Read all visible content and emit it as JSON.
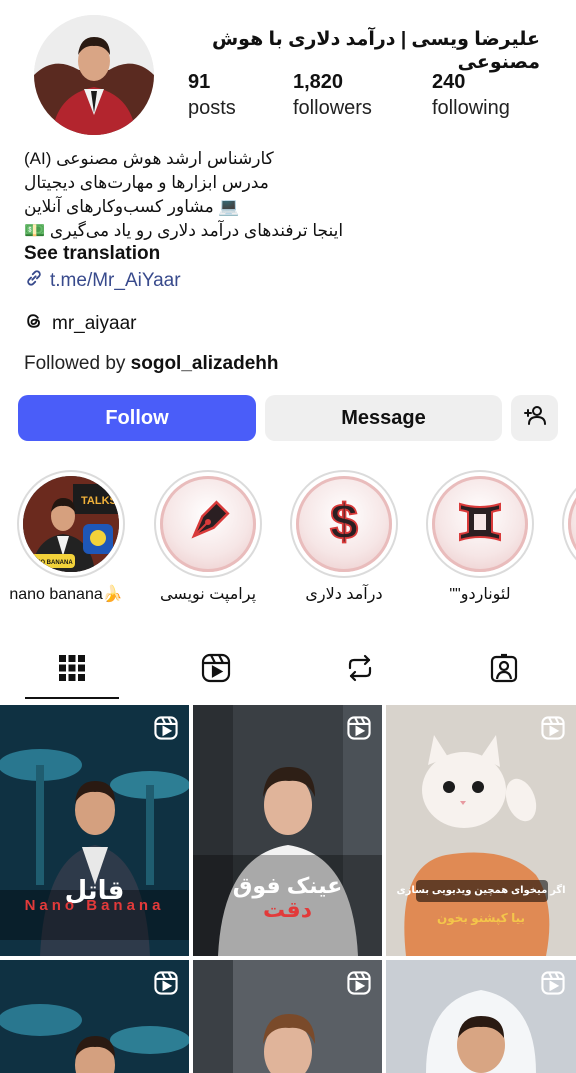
{
  "profile": {
    "display_name": "علیرضا ویسی | درآمد دلاری با هوش مصنوعی",
    "stats": [
      {
        "value": "91",
        "label": "posts"
      },
      {
        "value": "1,820",
        "label": "followers"
      },
      {
        "value": "240",
        "label": "following"
      }
    ],
    "bio_lines": [
      "(AI) کارشناس ارشد هوش مصنوعی",
      "مدرس ابزارها و مهارت‌های دیجیتال",
      "💻 مشاور کسب‌وکارهای آنلاین",
      "اینجا ترفندهای درآمد دلاری رو یاد می‌گیری 💵"
    ],
    "see_translation": "See translation",
    "link": "t.me/Mr_AiYaar",
    "threads_handle": "mr_aiyaar",
    "followed_by_prefix": "Followed by ",
    "followed_by_user": "sogol_alizadehh"
  },
  "actions": {
    "follow": "Follow",
    "message": "Message"
  },
  "highlights": [
    {
      "label": "nano banana🍌",
      "icon": "photo"
    },
    {
      "label": "پرامپت نویسی",
      "icon": "pen-nib-icon"
    },
    {
      "label": "درآمد دلاری",
      "icon": "dollar-icon"
    },
    {
      "label": "لئوناردو\"\"",
      "icon": "gemini-icon"
    }
  ],
  "highlight_photo_texts": {
    "banner": "TALKS",
    "badge": "NANO BANANA"
  },
  "tabs": [
    "grid-icon",
    "reels-icon",
    "reposts-icon",
    "tagged-icon"
  ],
  "posts": [
    {
      "caption_top": "قاتل",
      "caption_bottom": "Nano Banana"
    },
    {
      "caption_top": "عینک فوق",
      "caption_bottom": "دقت"
    },
    {
      "caption_top": "اگر میخوای همچین ویدیویی بسازی",
      "caption_bottom": "بیا کپشنو بخون"
    }
  ],
  "colors": {
    "accent": "#4a5df9",
    "link": "#384a8c",
    "button_bg": "#efefef",
    "highlight_red": "#d93a3a"
  }
}
